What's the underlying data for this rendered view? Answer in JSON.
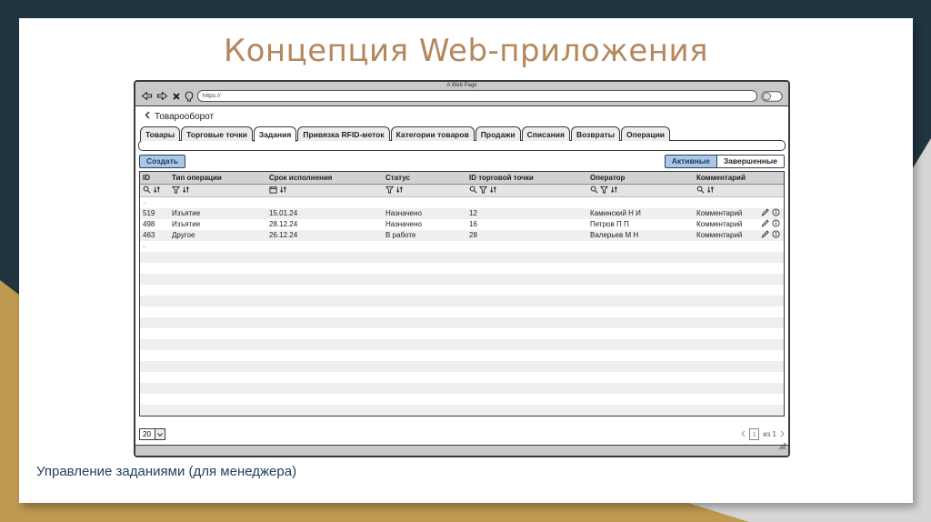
{
  "slide": {
    "title": "Концепция Web-приложения",
    "caption": "Управление заданиями (для менеджера)"
  },
  "browser": {
    "window_title": "A Web Page",
    "url": "https://"
  },
  "breadcrumb": {
    "label": "Товарооборот"
  },
  "tabs": [
    "Товары",
    "Торговые точки",
    "Задания",
    "Привязка RFID-меток",
    "Категории товаров",
    "Продажи",
    "Списания",
    "Возвраты",
    "Операции"
  ],
  "toolbar": {
    "create": "Создать",
    "active_filter": "Активные",
    "completed_filter": "Завершенные"
  },
  "table": {
    "columns": [
      "ID",
      "Тип операции",
      "Срок исполнения",
      "Статус",
      "ID торговой точки",
      "Оператор",
      "Комментарий"
    ],
    "ellipsis": "..",
    "rows": [
      {
        "id": "519",
        "type": "Изъятие",
        "due": "15.01.24",
        "status": "Назначено",
        "point": "12",
        "operator": "Каминский Н И",
        "comment": "Комментарий"
      },
      {
        "id": "498",
        "type": "Изъятие",
        "due": "28.12.24",
        "status": "Назначено",
        "point": "16",
        "operator": "Петров П П",
        "comment": "Комментарий"
      },
      {
        "id": "463",
        "type": "Другое",
        "due": "26.12.24",
        "status": "В работе",
        "point": "28",
        "operator": "Валерьев М Н",
        "comment": "Комментарий"
      }
    ]
  },
  "pagination": {
    "page_size": "20",
    "current_page": "1",
    "of_label": "из 1"
  },
  "colors": {
    "teal": "#203540",
    "gold": "#bf9950",
    "title-brown": "#b5875d",
    "caption-navy": "#24405e",
    "accent-blue": "#aac7e8",
    "wire-border": "#3a3a3a"
  }
}
